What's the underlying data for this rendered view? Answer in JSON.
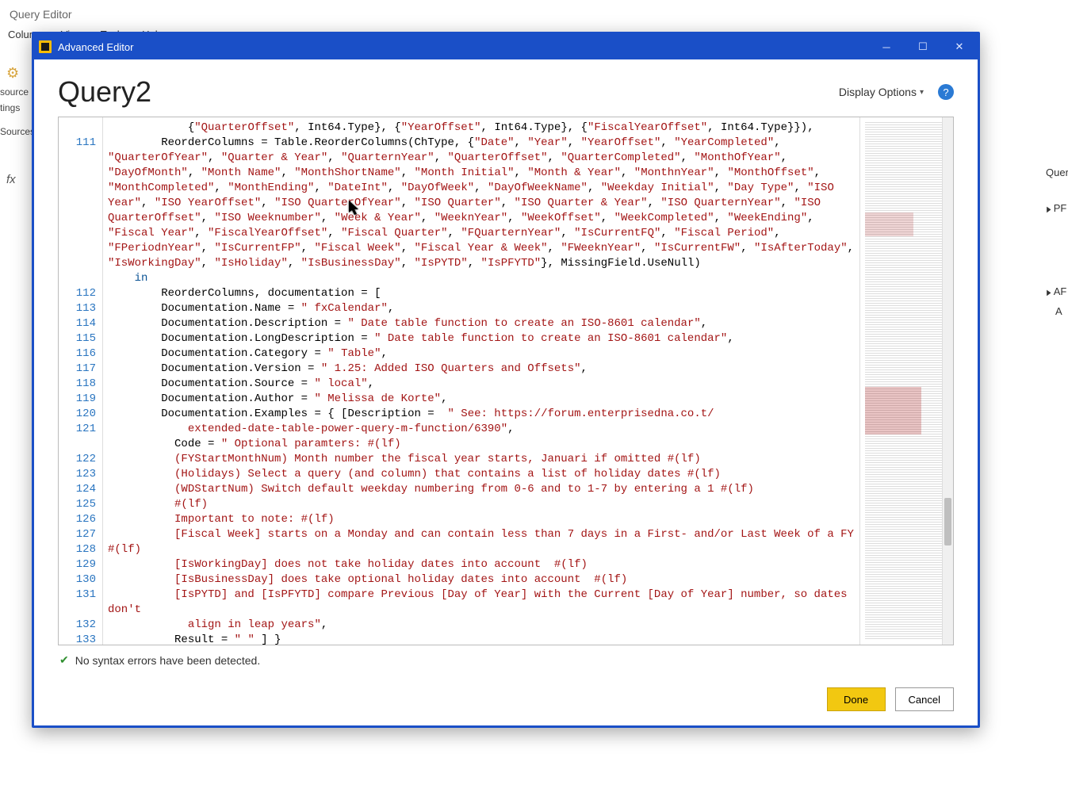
{
  "bg": {
    "title": "Query Editor",
    "menu": [
      "Column",
      "View",
      "Tools",
      "Help"
    ],
    "leftPanel": [
      "source",
      "tings",
      "Sources"
    ],
    "fx": "fx",
    "right": [
      "Quer",
      "PF",
      "AF",
      "A"
    ]
  },
  "modal": {
    "title": "Advanced Editor",
    "queryName": "Query2",
    "displayOptions": "Display Options",
    "status": "No syntax errors have been detected.",
    "done": "Done",
    "cancel": "Cancel"
  },
  "gutter": {
    "start": 111,
    "end": 133,
    "blanksBefore": 1,
    "wraps": {
      "111": 9,
      "121": 1,
      "131": 1
    }
  },
  "code": {
    "topLine": {
      "pre1": "            {",
      "s1": "\"QuarterOffset\"",
      "mid1": ", Int64.Type}, {",
      "s2": "\"YearOffset\"",
      "mid2": ", Int64.Type}, {",
      "s3": "\"FiscalYearOffset\"",
      "post": ", Int64.Type}}),"
    },
    "l111": {
      "pre": "        ReorderColumns = Table.ReorderColumns(ChType, {",
      "cols": [
        "Date",
        "Year",
        "YearOffset",
        "YearCompleted",
        "QuarterOfYear",
        "Quarter & Year",
        "QuarternYear",
        "QuarterOffset",
        "QuarterCompleted",
        "MonthOfYear",
        "DayOfMonth",
        "Month Name",
        "MonthShortName",
        "Month Initial",
        "Month & Year",
        "MonthnYear",
        "MonthOffset",
        "MonthCompleted",
        "MonthEnding",
        "DateInt",
        "DayOfWeek",
        "DayOfWeekName",
        "Weekday Initial",
        "Day Type",
        "ISO Year",
        "ISO YearOffset",
        "ISO QuarterOfYear",
        "ISO Quarter",
        "ISO Quarter & Year",
        "ISO QuarternYear",
        "ISO QuarterOffset",
        "ISO Weeknumber",
        "Week & Year",
        "WeeknYear",
        "WeekOffset",
        "WeekCompleted",
        "WeekEnding",
        "Fiscal Year",
        "FiscalYearOffset",
        "Fiscal Quarter",
        "FQuarternYear",
        "IsCurrentFQ",
        "Fiscal Period",
        "FPeriodnYear",
        "IsCurrentFP",
        "Fiscal Week",
        "Fiscal Year & Week",
        "FWeeknYear",
        "IsCurrentFW",
        "IsAfterToday",
        "IsWorkingDay",
        "IsHoliday",
        "IsBusinessDay",
        "IsPYTD",
        "IsPFYTD"
      ],
      "post": "}, MissingField.UseNull)"
    },
    "l112": "    in",
    "l113": "        ReorderColumns, documentation = [",
    "l114": {
      "pre": "        Documentation.Name = ",
      "s": "\" fxCalendar\"",
      "post": ","
    },
    "l115": {
      "pre": "        Documentation.Description = ",
      "s": "\" Date table function to create an ISO-8601 calendar\"",
      "post": ","
    },
    "l116": {
      "pre": "        Documentation.LongDescription = ",
      "s": "\" Date table function to create an ISO-8601 calendar\"",
      "post": ","
    },
    "l117": {
      "pre": "        Documentation.Category = ",
      "s": "\" Table\"",
      "post": ","
    },
    "l118": {
      "pre": "        Documentation.Version = ",
      "s": "\" 1.25: Added ISO Quarters and Offsets\"",
      "post": ","
    },
    "l119": {
      "pre": "        Documentation.Source = ",
      "s": "\" local\"",
      "post": ","
    },
    "l120": {
      "pre": "        Documentation.Author = ",
      "s": "\" Melissa de Korte\"",
      "post": ","
    },
    "l121": {
      "pre": "        Documentation.Examples = { [Description =  ",
      "s": "\" See: https://forum.enterprisedna.co.t/\n            extended-date-table-power-query-m-function/6390\"",
      "post": ","
    },
    "l122": {
      "pre": "          Code = ",
      "s": "\" Optional paramters: #(lf)"
    },
    "l123": "          (FYStartMonthNum) Month number the fiscal year starts, Januari if omitted #(lf)",
    "l124": "          (Holidays) Select a query (and column) that contains a list of holiday dates #(lf)",
    "l125": "          (WDStartNum) Switch default weekday numbering from 0-6 and to 1-7 by entering a 1 #(lf)",
    "l126": "          #(lf)",
    "l127": "          Important to note: #(lf)",
    "l128": "          [Fiscal Week] starts on a Monday and can contain less than 7 days in a First- and/or Last Week of a FY #(lf)",
    "l129": "          [IsWorkingDay] does not take holiday dates into account  #(lf)",
    "l130": "          [IsBusinessDay] does take optional holiday dates into account  #(lf)",
    "l131": "          [IsPYTD] and [IsPFYTD] compare Previous [Day of Year] with the Current [Day of Year] number, so dates don't\n            align in leap years\"",
    "l131post": ",",
    "l132": {
      "pre": "          Result = ",
      "s": "\" \"",
      "post": " ] }"
    },
    "l133": "        ]"
  },
  "chart_data": null
}
